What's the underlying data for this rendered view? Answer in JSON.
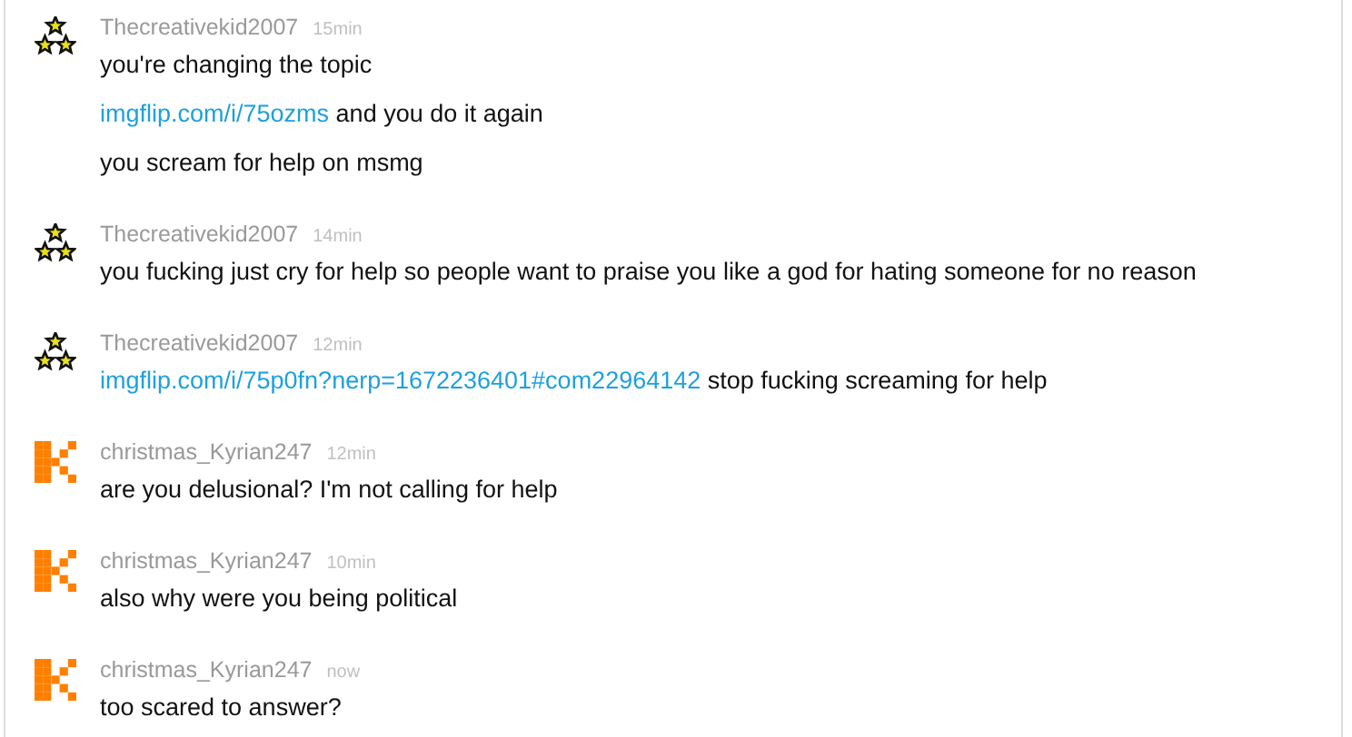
{
  "messages": [
    {
      "avatar": {
        "kind": "stars"
      },
      "username": "Thecreativekid2007",
      "time": "15min",
      "lines": [
        {
          "text": "you're changing the topic"
        },
        {
          "link": "imgflip.com/i/75ozms",
          "text": " and you do it again"
        },
        {
          "text": "you scream for help on msmg"
        }
      ]
    },
    {
      "avatar": {
        "kind": "stars"
      },
      "username": "Thecreativekid2007",
      "time": "14min",
      "lines": [
        {
          "text": "you fucking just cry for help so people want to praise you like a god for hating someone for no reason"
        }
      ]
    },
    {
      "avatar": {
        "kind": "stars"
      },
      "username": "Thecreativekid2007",
      "time": "12min",
      "lines": [
        {
          "link": "imgflip.com/i/75p0fn?nerp=1672236401#com22964142",
          "text": " stop fucking screaming for help"
        }
      ]
    },
    {
      "avatar": {
        "kind": "k"
      },
      "username": "christmas_Kyrian247",
      "time": "12min",
      "lines": [
        {
          "text": "are you delusional? I'm not calling for help"
        }
      ]
    },
    {
      "avatar": {
        "kind": "k"
      },
      "username": "christmas_Kyrian247",
      "time": "10min",
      "lines": [
        {
          "text": "also why were you being political"
        }
      ]
    },
    {
      "avatar": {
        "kind": "k"
      },
      "username": "christmas_Kyrian247",
      "time": "now",
      "lines": [
        {
          "text": "too scared to answer?"
        }
      ]
    }
  ]
}
